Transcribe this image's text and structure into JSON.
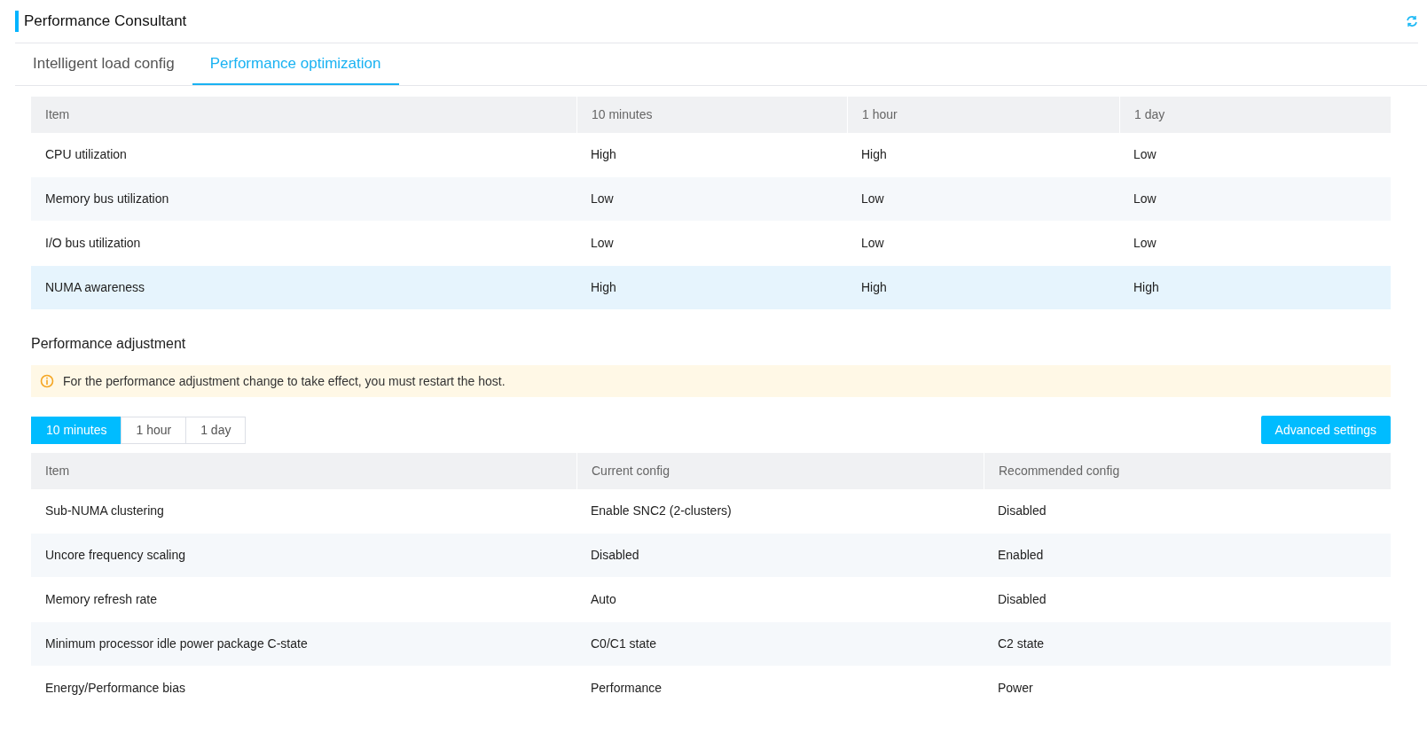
{
  "header": {
    "title": "Performance Consultant"
  },
  "tabs": [
    {
      "label": "Intelligent load config",
      "selected": false
    },
    {
      "label": "Performance optimization",
      "selected": true
    }
  ],
  "usage_table": {
    "columns": [
      "Item",
      "10 minutes",
      "1 hour",
      "1 day"
    ],
    "rows": [
      {
        "cells": [
          "CPU utilization",
          "High",
          "High",
          "Low"
        ],
        "selected": false
      },
      {
        "cells": [
          "Memory bus utilization",
          "Low",
          "Low",
          "Low"
        ],
        "selected": false
      },
      {
        "cells": [
          "I/O bus utilization",
          "Low",
          "Low",
          "Low"
        ],
        "selected": false
      },
      {
        "cells": [
          "NUMA awareness",
          "High",
          "High",
          "High"
        ],
        "selected": true
      }
    ]
  },
  "adjustment": {
    "title": "Performance adjustment",
    "alert": "For the performance adjustment change to take effect, you must restart the host.",
    "periods": [
      {
        "label": "10 minutes",
        "selected": true
      },
      {
        "label": "1 hour",
        "selected": false
      },
      {
        "label": "1 day",
        "selected": false
      }
    ],
    "advanced_button": "Advanced settings",
    "table": {
      "columns": [
        "Item",
        "Current config",
        "Recommended config"
      ],
      "rows": [
        [
          "Sub-NUMA clustering",
          "Enable SNC2 (2-clusters)",
          "Disabled"
        ],
        [
          "Uncore frequency scaling",
          "Disabled",
          "Enabled"
        ],
        [
          "Memory refresh rate",
          "Auto",
          "Disabled"
        ],
        [
          "Minimum processor idle power package C-state",
          "C0/C1 state",
          "C2 state"
        ],
        [
          "Energy/Performance bias",
          "Performance",
          "Power"
        ]
      ]
    }
  }
}
